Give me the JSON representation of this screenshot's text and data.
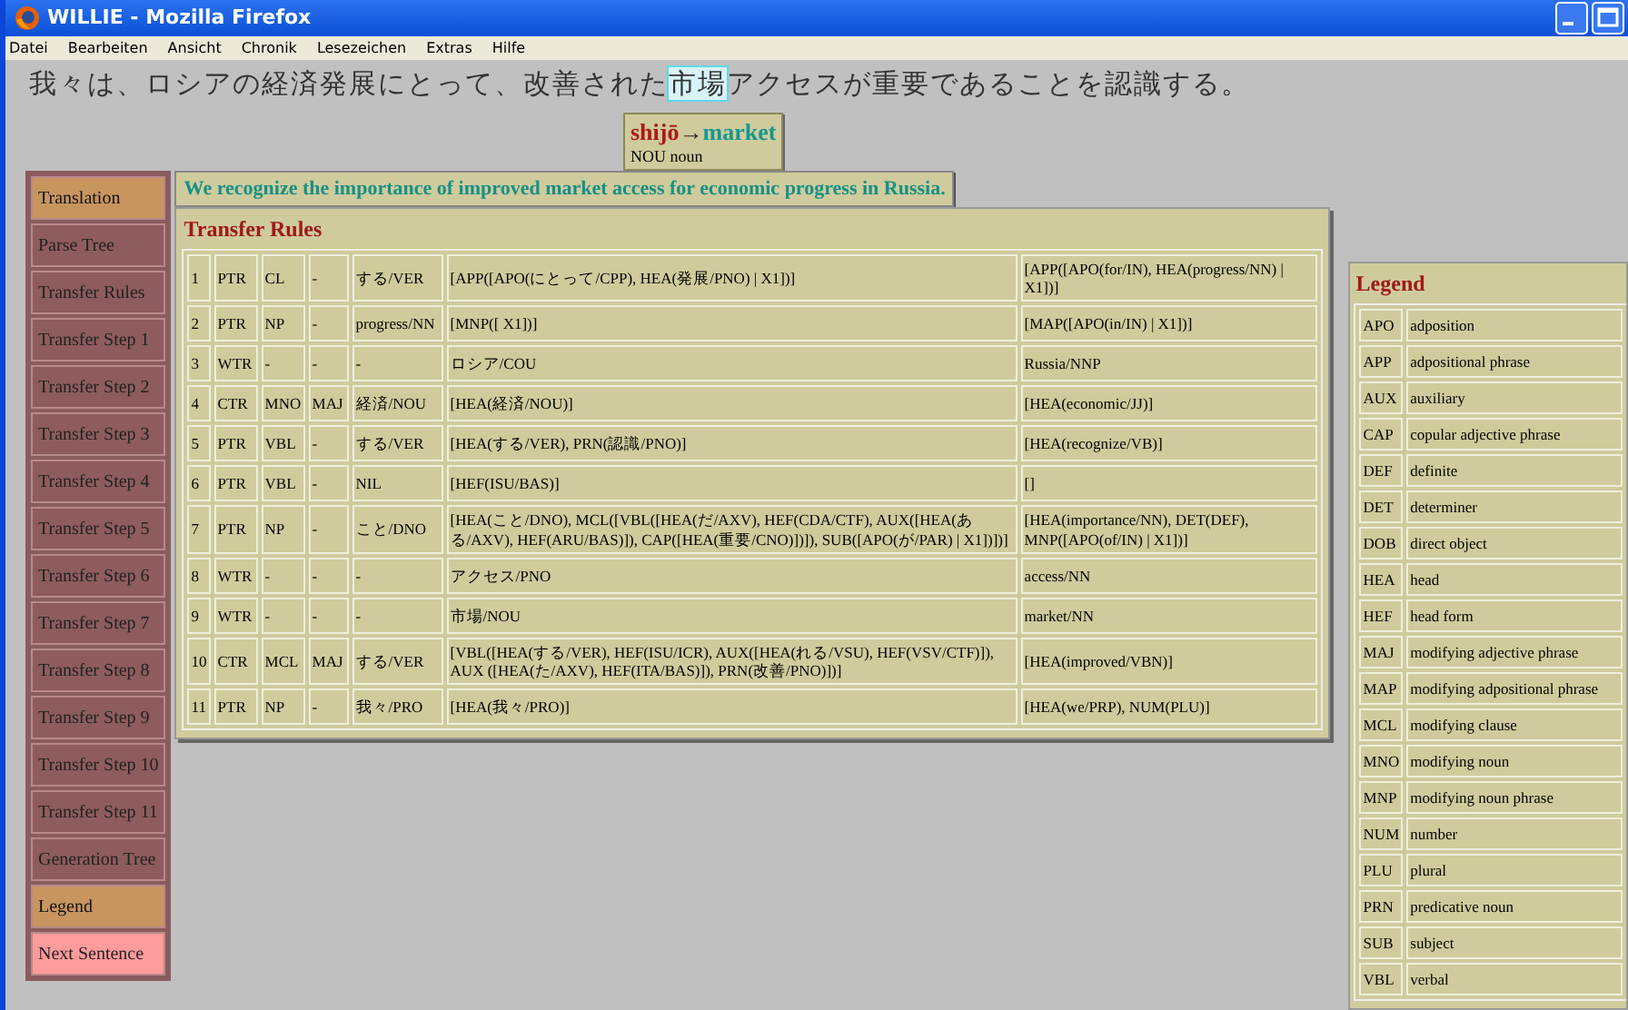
{
  "window": {
    "title": "WILLIE - Mozilla Firefox"
  },
  "menu": [
    "Datei",
    "Bearbeiten",
    "Ansicht",
    "Chronik",
    "Lesezeichen",
    "Extras",
    "Hilfe"
  ],
  "sentence": [
    {
      "text": "我々は、ロシアの経済発展にとって、改善された",
      "highlighted": false
    },
    {
      "text": "市場",
      "highlighted": true
    },
    {
      "text": "アクセスが重要であることを認識する。",
      "highlighted": false
    }
  ],
  "popup": {
    "reading": "shijō",
    "arrow": "→",
    "translation": "market",
    "pos": "NOU noun"
  },
  "sidebar": [
    {
      "label": "Translation",
      "kind": "view",
      "selected": true
    },
    {
      "label": "Parse Tree",
      "kind": "view",
      "selected": false
    },
    {
      "label": "Transfer Rules",
      "kind": "view",
      "selected": false
    },
    {
      "label": "Transfer Step 1",
      "kind": "view",
      "selected": false
    },
    {
      "label": "Transfer Step 2",
      "kind": "view",
      "selected": false
    },
    {
      "label": "Transfer Step 3",
      "kind": "view",
      "selected": false
    },
    {
      "label": "Transfer Step 4",
      "kind": "view",
      "selected": false
    },
    {
      "label": "Transfer Step 5",
      "kind": "view",
      "selected": false
    },
    {
      "label": "Transfer Step 6",
      "kind": "view",
      "selected": false
    },
    {
      "label": "Transfer Step 7",
      "kind": "view",
      "selected": false
    },
    {
      "label": "Transfer Step 8",
      "kind": "view",
      "selected": false
    },
    {
      "label": "Transfer Step 9",
      "kind": "view",
      "selected": false
    },
    {
      "label": "Transfer Step 10",
      "kind": "view",
      "selected": false
    },
    {
      "label": "Transfer Step 11",
      "kind": "view",
      "selected": false
    },
    {
      "label": "Generation Tree",
      "kind": "view",
      "selected": false
    },
    {
      "label": "Legend",
      "kind": "view",
      "selected": true
    },
    {
      "label": "Next Sentence",
      "kind": "action",
      "selected": false
    }
  ],
  "translation": "We recognize the importance of improved market access for economic progress in Russia.",
  "transfer_rules": {
    "title": "Transfer Rules",
    "rows": [
      [
        "1",
        "PTR",
        "CL",
        "-",
        "する/VER",
        "[APP([APO(にとって/CPP), HEA(発展/PNO) | X1])]",
        "[APP([APO(for/IN), HEA(progress/NN) | X1])]"
      ],
      [
        "2",
        "PTR",
        "NP",
        "-",
        "progress/NN",
        "[MNP([ X1])]",
        "[MAP([APO(in/IN) | X1])]"
      ],
      [
        "3",
        "WTR",
        "-",
        "-",
        "-",
        "ロシア/COU",
        "Russia/NNP"
      ],
      [
        "4",
        "CTR",
        "MNO",
        "MAJ",
        "経済/NOU",
        "[HEA(経済/NOU)]",
        "[HEA(economic/JJ)]"
      ],
      [
        "5",
        "PTR",
        "VBL",
        "-",
        "する/VER",
        "[HEA(する/VER), PRN(認識/PNO)]",
        "[HEA(recognize/VB)]"
      ],
      [
        "6",
        "PTR",
        "VBL",
        "-",
        "NIL",
        "[HEF(ISU/BAS)]",
        "[]"
      ],
      [
        "7",
        "PTR",
        "NP",
        "-",
        "こと/DNO",
        "[HEA(こと/DNO), MCL([VBL([HEA(だ/AXV), HEF(CDA/CTF), AUX([HEA(ある/AXV), HEF(ARU/BAS)]), CAP([HEA(重要/CNO)])]), SUB([APO(が/PAR) | X1])])]",
        "[HEA(importance/NN), DET(DEF), MNP([APO(of/IN) | X1])]"
      ],
      [
        "8",
        "WTR",
        "-",
        "-",
        "-",
        "アクセス/PNO",
        "access/NN"
      ],
      [
        "9",
        "WTR",
        "-",
        "-",
        "-",
        "市場/NOU",
        "market/NN"
      ],
      [
        "10",
        "CTR",
        "MCL",
        "MAJ",
        "する/VER",
        "[VBL([HEA(する/VER), HEF(ISU/ICR), AUX([HEA(れる/VSU), HEF(VSV/CTF)]), AUX ([HEA(た/AXV), HEF(ITA/BAS)]), PRN(改善/PNO)])]",
        "[HEA(improved/VBN)]"
      ],
      [
        "11",
        "PTR",
        "NP",
        "-",
        "我々/PRO",
        "[HEA(我々/PRO)]",
        "[HEA(we/PRP), NUM(PLU)]"
      ]
    ]
  },
  "legend": {
    "title": "Legend",
    "rows": [
      [
        "APO",
        "adposition"
      ],
      [
        "APP",
        "adpositional phrase"
      ],
      [
        "AUX",
        "auxiliary"
      ],
      [
        "CAP",
        "copular adjective phrase"
      ],
      [
        "DEF",
        "definite"
      ],
      [
        "DET",
        "determiner"
      ],
      [
        "DOB",
        "direct object"
      ],
      [
        "HEA",
        "head"
      ],
      [
        "HEF",
        "head form"
      ],
      [
        "MAJ",
        "modifying adjective phrase"
      ],
      [
        "MAP",
        "modifying adpositional phrase"
      ],
      [
        "MCL",
        "modifying clause"
      ],
      [
        "MNO",
        "modifying noun"
      ],
      [
        "MNP",
        "modifying noun phrase"
      ],
      [
        "NUM",
        "number"
      ],
      [
        "PLU",
        "plural"
      ],
      [
        "PRN",
        "predicative noun"
      ],
      [
        "SUB",
        "subject"
      ],
      [
        "VBL",
        "verbal"
      ]
    ]
  }
}
